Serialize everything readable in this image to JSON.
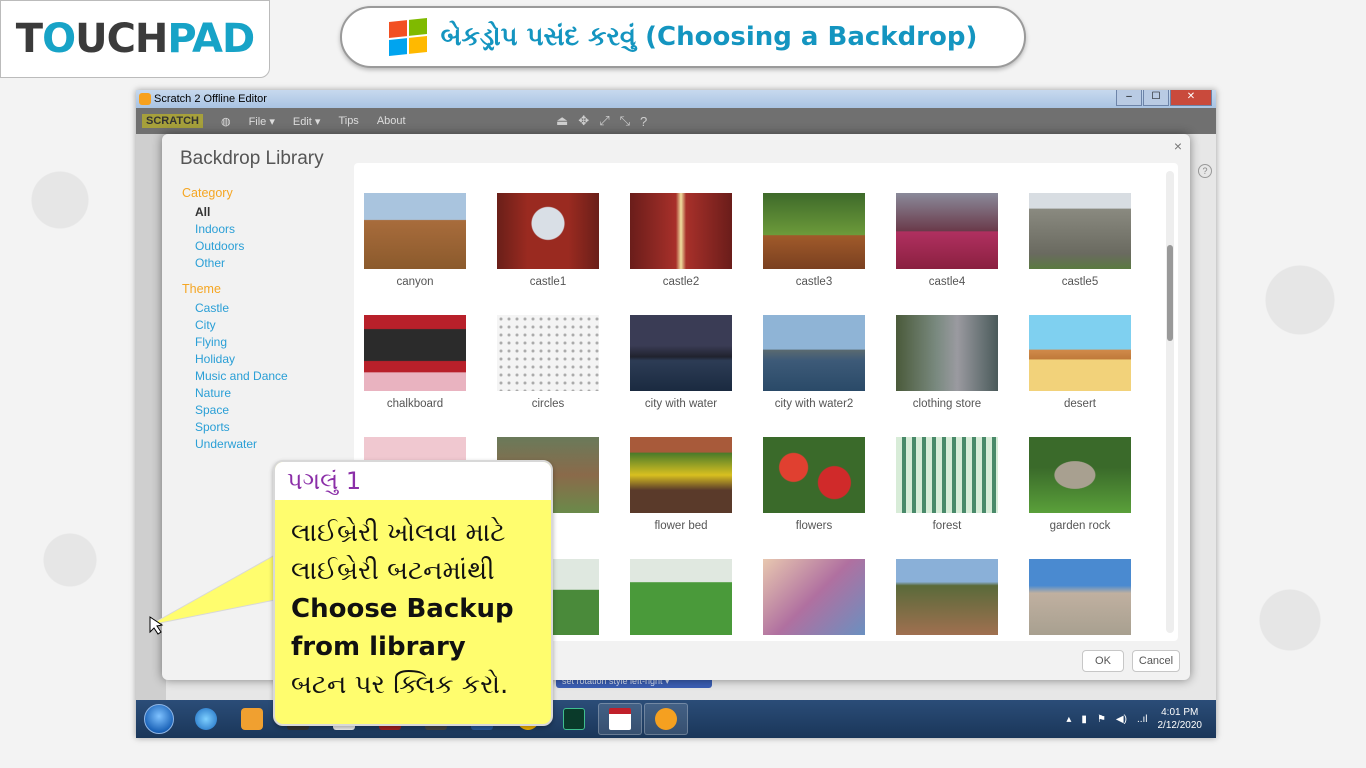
{
  "brand": {
    "logo_a": "T",
    "logo_o": "O",
    "logo_rest": "UCH",
    "logo_pad": "PAD"
  },
  "title": {
    "text": "બેકડ્રોપ પસંદ કરવું (Choosing a Backdrop)"
  },
  "window": {
    "title": "Scratch 2 Offline Editor",
    "min": "–",
    "max": "☐",
    "close": "✕"
  },
  "menu": {
    "logo": "SCRATCH",
    "file": "File ▾",
    "edit": "Edit ▾",
    "tips": "Tips",
    "about": "About"
  },
  "dialog": {
    "title": "Backdrop Library",
    "close": "×",
    "category_head": "Category",
    "categories": [
      "All",
      "Indoors",
      "Outdoors",
      "Other"
    ],
    "theme_head": "Theme",
    "themes": [
      "Castle",
      "City",
      "Flying",
      "Holiday",
      "Music and Dance",
      "Nature",
      "Space",
      "Sports",
      "Underwater"
    ],
    "items": [
      "canyon",
      "castle1",
      "castle2",
      "castle3",
      "castle4",
      "castle5",
      "chalkboard",
      "circles",
      "city with water",
      "city with water2",
      "clothing store",
      "desert",
      "",
      "",
      "flower bed",
      "flowers",
      "forest",
      "garden rock",
      "",
      "",
      "",
      "",
      "",
      ""
    ],
    "ok": "OK",
    "cancel": "Cancel"
  },
  "editor": {
    "block_text": "set rotation style  left-right ▾",
    "help": "?"
  },
  "callout": {
    "head": "પગલું 1",
    "line1": "લાઈબ્રેરી ખોલવા માટે",
    "line2": "લાઈબ્રેરી બટનમાંથી",
    "line3": "Choose Backup",
    "line4": "from library",
    "line5": "બટન પર ક્લિક કરો."
  },
  "taskbar": {
    "time": "4:01 PM",
    "date": "2/12/2020",
    "tray_arrow": "▴"
  },
  "colors": {
    "accent": "#1495c0",
    "category": "#f5a623",
    "link": "#2a9fd6",
    "callout": "#fffd6e"
  }
}
